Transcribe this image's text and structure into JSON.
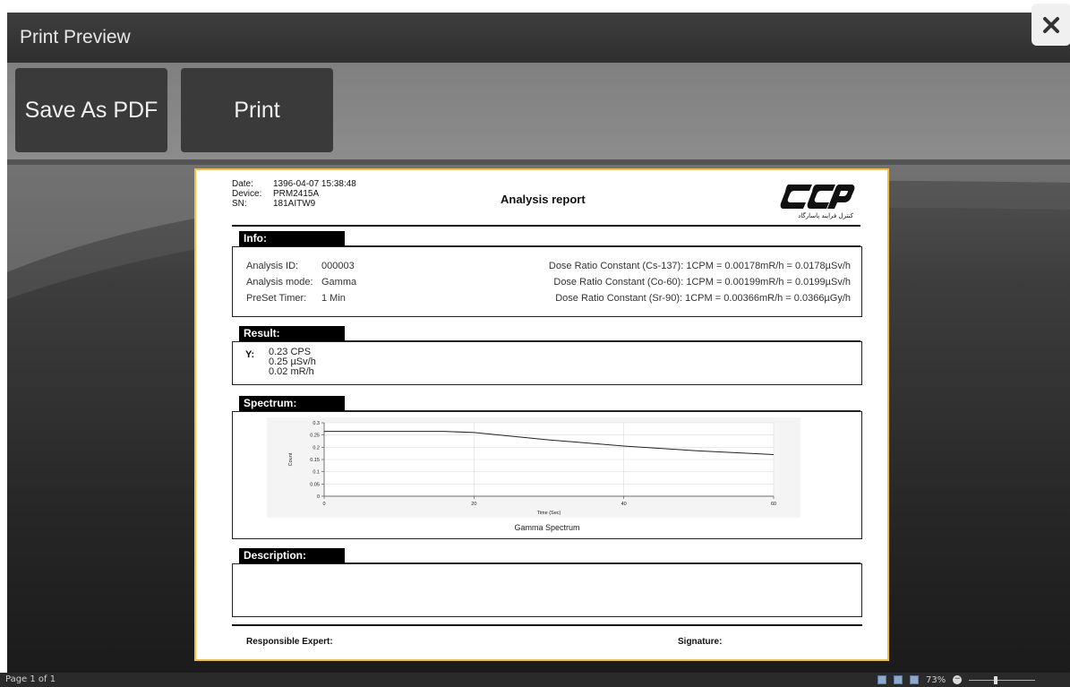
{
  "window": {
    "title": "Print Preview",
    "close_label": "✕"
  },
  "toolbar": {
    "save_pdf_label": "Save As PDF",
    "print_label": "Print"
  },
  "report": {
    "header": {
      "date_label": "Date:",
      "date_value": "1396-04-07 15:38:48",
      "device_label": "Device:",
      "device_value": "PRM2415A",
      "sn_label": "SN:",
      "sn_value": "181AITW9",
      "title": "Analysis report",
      "logo_text": "کنترل فرایند پاسارگاد"
    },
    "info": {
      "heading": "Info:",
      "analysis_id_label": "Analysis ID:",
      "analysis_id_value": "000003",
      "analysis_mode_label": "Analysis mode:",
      "analysis_mode_value": "Gamma",
      "preset_timer_label": "PreSet Timer:",
      "preset_timer_value": "1 Min",
      "dose_cs137": "Dose Ratio Constant (Cs-137): 1CPM = 0.00178mR/h = 0.0178µSv/h",
      "dose_co60": "Dose Ratio Constant (Co-60):  1CPM = 0.00199mR/h = 0.0199µSv/h",
      "dose_sr90": "Dose Ratio Constant (Sr-90):  1CPM = 0.00366mR/h = 0.0366µGy/h"
    },
    "result": {
      "heading": "Result:",
      "symbol": "Y:",
      "cps": "0.23 CPS",
      "usv": "0.25 µSv/h",
      "mrh": "0.02 mR/h"
    },
    "spectrum": {
      "heading": "Spectrum:"
    },
    "description": {
      "heading": "Description:"
    },
    "footer": {
      "expert_label": "Responsible Expert:",
      "signature_label": "Signature:"
    }
  },
  "chart_data": {
    "type": "line",
    "title": "Gamma Spectrum",
    "xlabel": "Time (Sec)",
    "ylabel": "Count",
    "xlim": [
      0,
      60
    ],
    "ylim": [
      0,
      0.3
    ],
    "x_ticks": [
      "0",
      "20",
      "40",
      "60"
    ],
    "y_ticks": [
      "0",
      "0.05",
      "0.1",
      "0.15",
      "0.2",
      "0.25",
      "0.3"
    ],
    "grid": true,
    "series": [
      {
        "x": [
          0,
          10,
          16,
          20,
          25,
          30,
          40,
          50,
          60
        ],
        "y": [
          0.265,
          0.265,
          0.265,
          0.26,
          0.245,
          0.23,
          0.205,
          0.185,
          0.17
        ]
      }
    ]
  },
  "statusbar": {
    "page_info": "Page 1 of 1",
    "zoom_level": "73%"
  }
}
